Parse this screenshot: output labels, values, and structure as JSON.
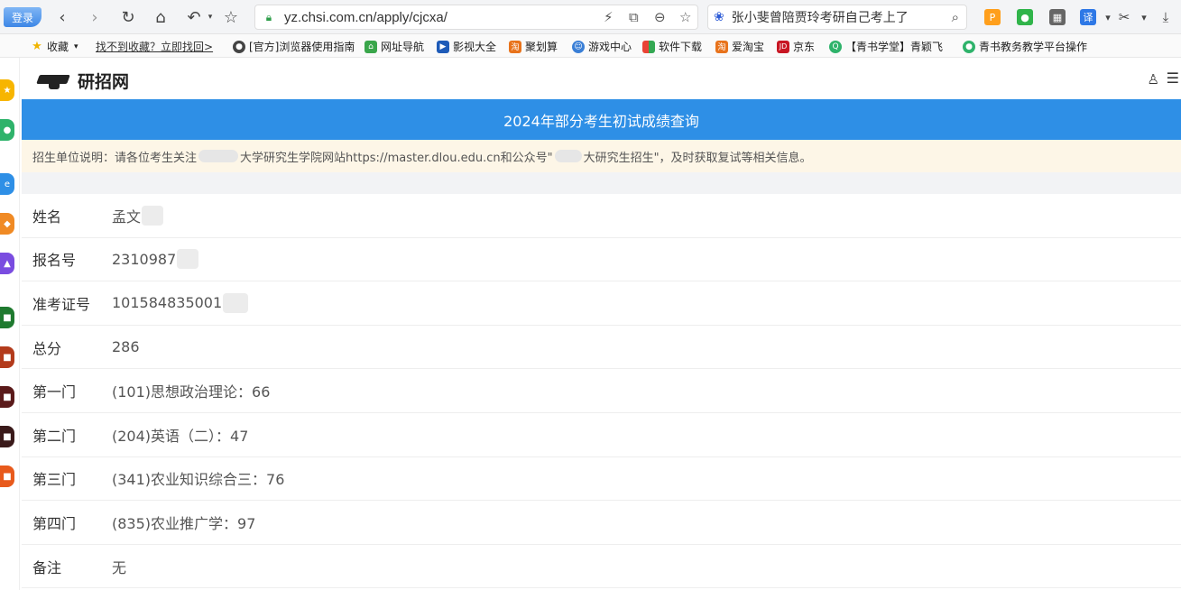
{
  "browser": {
    "login_label": "登录",
    "url": "yz.chsi.com.cn/apply/cjcxa/",
    "search_query": "张小斐曾陪贾玲考研自己考上了",
    "ext_translate": "译"
  },
  "bookmarks": {
    "favorites_label": "收藏",
    "find_label": "找不到收藏？立即找回>",
    "items": [
      "[官方]浏览器使用指南",
      "网址导航",
      "影视大全",
      "聚划算",
      "游戏中心",
      "软件下载",
      "爱淘宝",
      "京东",
      "【青书学堂】青颖飞",
      "青书教务教学平台操作"
    ]
  },
  "site": {
    "logo_text": "研招网"
  },
  "page": {
    "title": "2024年部分考生初试成绩查询",
    "notice_prefix": "招生单位说明：请各位考生关注",
    "notice_middle": "大学研究生学院网站https://master.dlou.edu.cn和公众号\"",
    "notice_suffix": "大研究生招生\"，及时获取复试等相关信息。"
  },
  "results": {
    "rows": [
      {
        "label": "姓名",
        "value": "孟文"
      },
      {
        "label": "报名号",
        "value": "2310987"
      },
      {
        "label": "准考证号",
        "value": "101584835001"
      },
      {
        "label": "总分",
        "value": "286"
      },
      {
        "label": "第一门",
        "value": "(101)思想政治理论：66"
      },
      {
        "label": "第二门",
        "value": "(204)英语（二）：47"
      },
      {
        "label": "第三门",
        "value": "(341)农业知识综合三：76"
      },
      {
        "label": "第四门",
        "value": "(835)农业推广学：97"
      },
      {
        "label": "备注",
        "value": "无"
      }
    ]
  }
}
